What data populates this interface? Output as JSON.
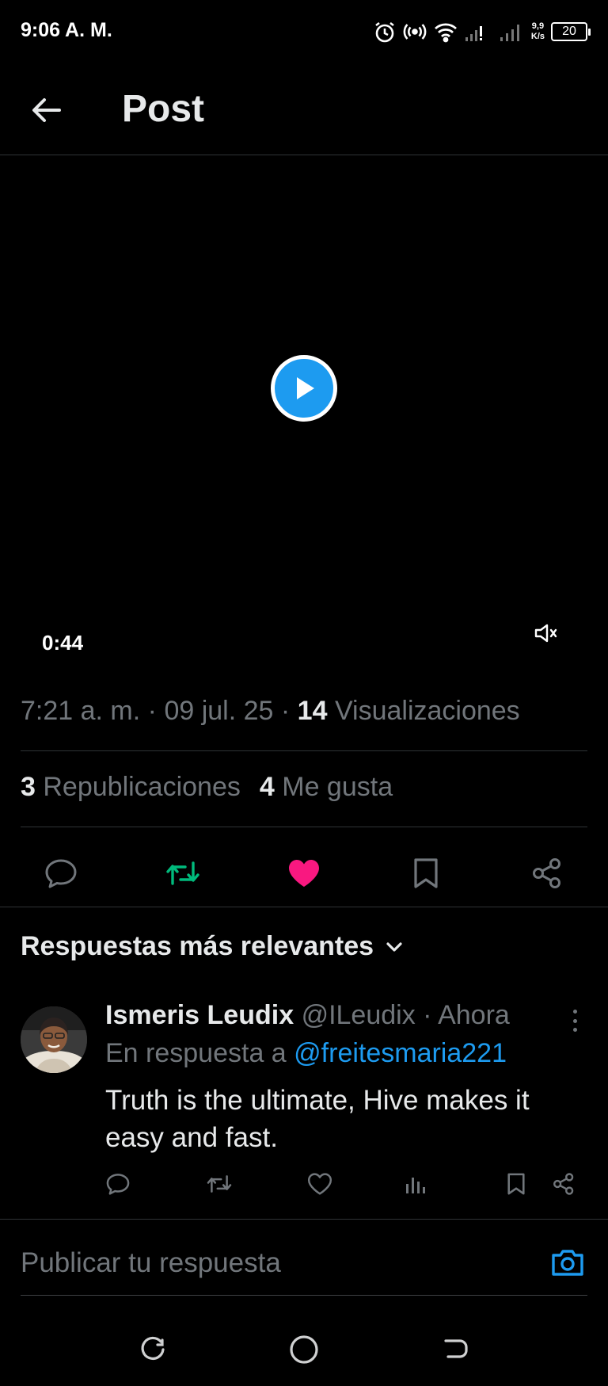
{
  "status_bar": {
    "time": "9:06 A. M.",
    "speed_value": "9,9",
    "speed_unit": "K/s",
    "battery": "20",
    "icons": [
      "alarm-icon",
      "hotspot-icon",
      "wifi-icon",
      "signal-icon",
      "signal-icon"
    ]
  },
  "header": {
    "title": "Post"
  },
  "video": {
    "duration": "0:44",
    "muted": true
  },
  "post_meta": {
    "time": "7:21 a. m.",
    "date": "09 jul. 25",
    "views_count": "14",
    "views_label": "Visualizaciones",
    "separator": "·"
  },
  "post_stats": {
    "reposts_count": "3",
    "reposts_label": "Republicaciones",
    "likes_count": "4",
    "likes_label": "Me gusta"
  },
  "actions": [
    "reply-icon",
    "repost-icon",
    "like-icon",
    "bookmark-icon",
    "share-icon"
  ],
  "replies": {
    "heading": "Respuestas más relevantes",
    "items": [
      {
        "name": "Ismeris Leudix",
        "handle": "@ILeudix",
        "time": "Ahora",
        "reply_prefix": "En respuesta a",
        "mention": "@freitesmaria221",
        "text": "Truth is the ultimate, Hive makes it easy and fast."
      }
    ]
  },
  "compose": {
    "placeholder": "Publicar tu respuesta"
  },
  "colors": {
    "background": "#000000",
    "accent": "#1d9bf0",
    "repost_active": "#00ba7c",
    "like_active": "#f91880",
    "muted_text": "#71767b",
    "primary_text": "#e7e9ea"
  }
}
